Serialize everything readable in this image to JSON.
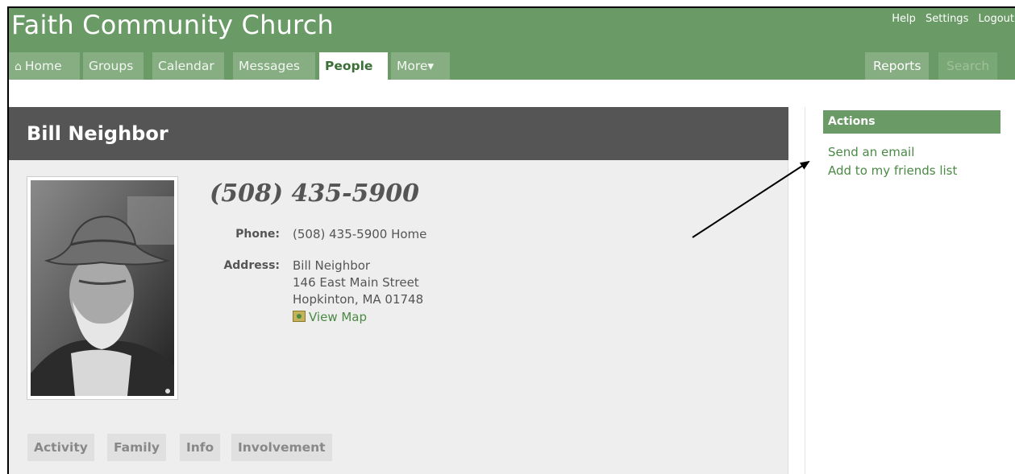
{
  "header": {
    "site_title": "Faith Community Church",
    "top_links": [
      "Help",
      "Settings",
      "Logout"
    ],
    "brand_color": "#6a9a66"
  },
  "nav": {
    "tabs": [
      {
        "label": "Home",
        "icon": "home-icon"
      },
      {
        "label": "Groups"
      },
      {
        "label": "Calendar"
      },
      {
        "label": "Messages"
      },
      {
        "label": "People",
        "active": true
      },
      {
        "label": "More▾"
      }
    ],
    "right_tabs": [
      {
        "label": "Reports"
      },
      {
        "label": "Search"
      }
    ]
  },
  "person": {
    "name": "Bill Neighbor",
    "headline_phone": "(508) 435-5900",
    "phone_label": "Phone:",
    "phone_value": "(508) 435-5900 Home",
    "address_label": "Address:",
    "address_lines": [
      "Bill Neighbor",
      "146 East Main Street",
      "Hopkinton, MA 01748"
    ],
    "map_link": "View Map",
    "photo_alt": "profile-photo"
  },
  "profile_tabs": [
    "Activity",
    "Family",
    "Info",
    "Involvement"
  ],
  "actions": {
    "title": "Actions",
    "links": [
      "Send an email",
      "Add to my friends list"
    ]
  }
}
